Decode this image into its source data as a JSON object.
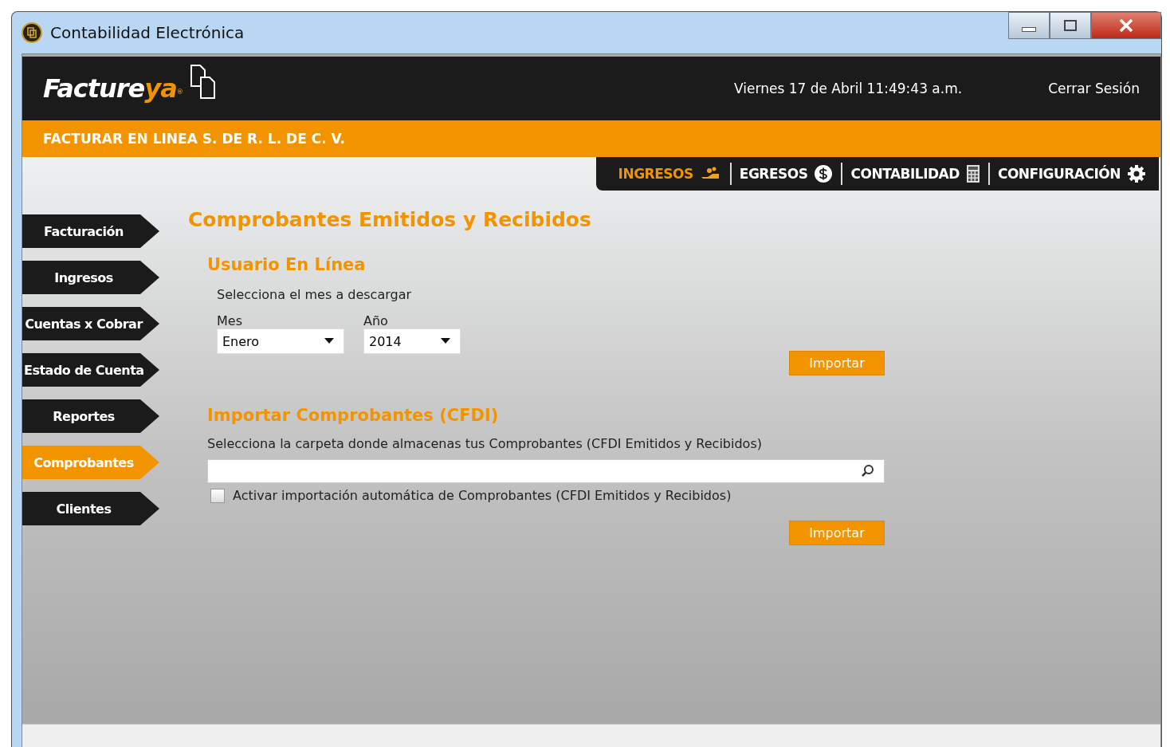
{
  "window": {
    "title": "Contabilidad Electrónica"
  },
  "header": {
    "logo_main": "Facture",
    "logo_accent": "ya",
    "logo_mark": "®",
    "datetime": "Viernes 17 de Abril 11:49:43 a.m.",
    "logout": "Cerrar Sesión"
  },
  "company": "FACTURAR EN LINEA S. DE R. L. DE C. V.",
  "tabs": [
    {
      "label": "INGRESOS",
      "kind": "hand",
      "selected": true
    },
    {
      "label": "EGRESOS",
      "kind": "dollar",
      "selected": false
    },
    {
      "label": "CONTABILIDAD",
      "kind": "calculator",
      "selected": false
    },
    {
      "label": "CONFIGURACIÓN",
      "kind": "gear",
      "selected": false
    }
  ],
  "sidebar": {
    "items": [
      {
        "label": "Facturación",
        "selected": false
      },
      {
        "label": "Ingresos",
        "selected": false
      },
      {
        "label": "Cuentas x Cobrar",
        "selected": false
      },
      {
        "label": "Estado de Cuenta",
        "selected": false
      },
      {
        "label": "Reportes",
        "selected": false
      },
      {
        "label": "Comprobantes",
        "selected": true
      },
      {
        "label": "Clientes",
        "selected": false
      }
    ]
  },
  "page_title": "Comprobantes Emitidos y Recibidos",
  "online": {
    "title": "Usuario En Línea",
    "instruction": "Selecciona el mes a descargar",
    "selects": [
      {
        "label": "Mes",
        "value": "Enero"
      },
      {
        "label": "Año",
        "value": "2014"
      }
    ],
    "button": "Importar"
  },
  "import": {
    "title": "Importar Comprobantes (CFDI)",
    "instruction": "Selecciona la carpeta donde almacenas tus Comprobantes (CFDI Emitidos y Recibidos)",
    "checkbox": {
      "label": "Activar importación automática de Comprobantes (CFDI Emitidos y Recibidos)",
      "checked": false
    },
    "button": "Importar"
  }
}
